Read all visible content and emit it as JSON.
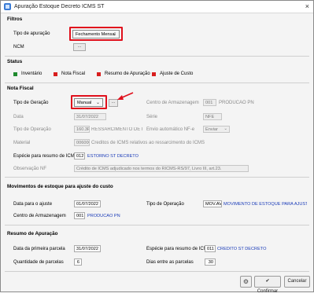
{
  "window": {
    "title": "Apuração Estoque Decreto ICMS ST",
    "close": "×"
  },
  "filtros": {
    "section": "Filtros",
    "tipo_label": "Tipo de apuração",
    "tipo_value": "Fechamento Mensal",
    "ncm_label": "NCM",
    "ncm_btn": "..."
  },
  "status": {
    "section": "Status",
    "items": [
      {
        "label": "Inventário",
        "color": "#1f8a2e"
      },
      {
        "label": "Nota Fiscal",
        "color": "#d81e1e"
      },
      {
        "label": "Resumo de Apuração",
        "color": "#d81e1e"
      },
      {
        "label": "Ajuste de Custo",
        "color": "#d81e1e"
      }
    ]
  },
  "nota": {
    "section": "Nota Fiscal",
    "tipo_geracao_label": "Tipo de Geração",
    "tipo_geracao_value": "Manual",
    "btn": "...",
    "centro_label": "Centro de Armazenagem",
    "centro_code": "001",
    "centro_name": "PRODUCAO PN",
    "data_label": "Data",
    "data_value": "31/07/2022",
    "serie_label": "Série",
    "serie_value": "NFE",
    "tipo_op_label": "Tipo de Operação",
    "tipo_op_code": "160.3R",
    "tipo_op_name": "RESSARCIMENTO DE ICMS I",
    "envio_label": "Envio automático NF-e",
    "envio_value": "Enviar",
    "material_label": "Material",
    "material_code": "006000",
    "material_name": "Creditos de ICMS relativos ao ressarcimento do ICMS",
    "especie_label": "Espécie para resumo de ICMS",
    "especie_code": "012",
    "especie_name": "ESTORNO ST DECRETO",
    "obs_label": "Observação NF",
    "obs_value": "Crédito de ICMS adjudicado nos termos do RICMS-RS/97, Livro III, art.23."
  },
  "movimentos": {
    "section": "Movimentos de estoque para ajuste do custo",
    "data_label": "Data para o ajuste",
    "data_value": "01/07/2022",
    "tipo_op_label": "Tipo de Operação",
    "tipo_op_code": "MOV.AV",
    "tipo_op_name": "MOVIMENTO DE ESTOQUE PARA AJUSTE CU",
    "centro_label": "Centro de Armazenagem",
    "centro_code": "001",
    "centro_name": "PRODUCAO PN"
  },
  "resumo": {
    "section": "Resumo de Apuração",
    "data_label": "Data da primeira parcela",
    "data_value": "31/07/2022",
    "especie_label": "Espécie para resumo de ICMS",
    "especie_code": "011",
    "especie_name": "CREDITO ST DECRETO",
    "qtd_label": "Quantidade de parcelas",
    "qtd_value": "6",
    "dias_label": "Dias entre as parcelas",
    "dias_value": "30"
  },
  "footer": {
    "gear": "⚙",
    "confirm": "Confirmar",
    "cancel": "Cancelar"
  },
  "colors": {
    "highlight": "#e0101c",
    "link": "#1a3bb8"
  }
}
